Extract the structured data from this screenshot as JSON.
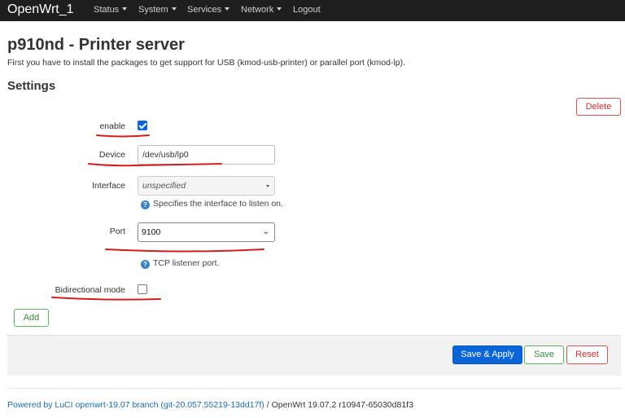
{
  "navbar": {
    "brand": "OpenWrt_1",
    "menu": [
      {
        "label": "Status",
        "has_caret": true
      },
      {
        "label": "System",
        "has_caret": true
      },
      {
        "label": "Services",
        "has_caret": true
      },
      {
        "label": "Network",
        "has_caret": true
      },
      {
        "label": "Logout",
        "has_caret": false
      }
    ]
  },
  "page": {
    "title": "p910nd - Printer server",
    "description": "First you have to install the packages to get support for USB (kmod-usb-printer) or parallel port (kmod-lp)."
  },
  "settings": {
    "title": "Settings",
    "delete_label": "Delete",
    "enable": {
      "label": "enable",
      "checked": true
    },
    "device": {
      "label": "Device",
      "value": "/dev/usb/lp0"
    },
    "interface": {
      "label": "Interface",
      "value": "unspecified",
      "help": "Specifies the interface to listen on."
    },
    "port": {
      "label": "Port",
      "value": "9100",
      "help": "TCP listener port."
    },
    "bidirectional": {
      "label": "Bidirectional mode",
      "checked": false
    },
    "add_label": "Add"
  },
  "actions": {
    "save_apply": "Save & Apply",
    "save": "Save",
    "reset": "Reset"
  },
  "footer": {
    "powered_by": "Powered by LuCI openwrt-19.07 branch (git-20.057.55219-13dd17f)",
    "separator": " / ",
    "version": "OpenWrt 19.07.2 r10947-65030d81f3"
  },
  "colors": {
    "navbar_bg": "#1e1e1e",
    "primary_blue": "#0a66d8",
    "annotation_red": "#d41c1c",
    "link_blue": "#1a6bb3"
  }
}
